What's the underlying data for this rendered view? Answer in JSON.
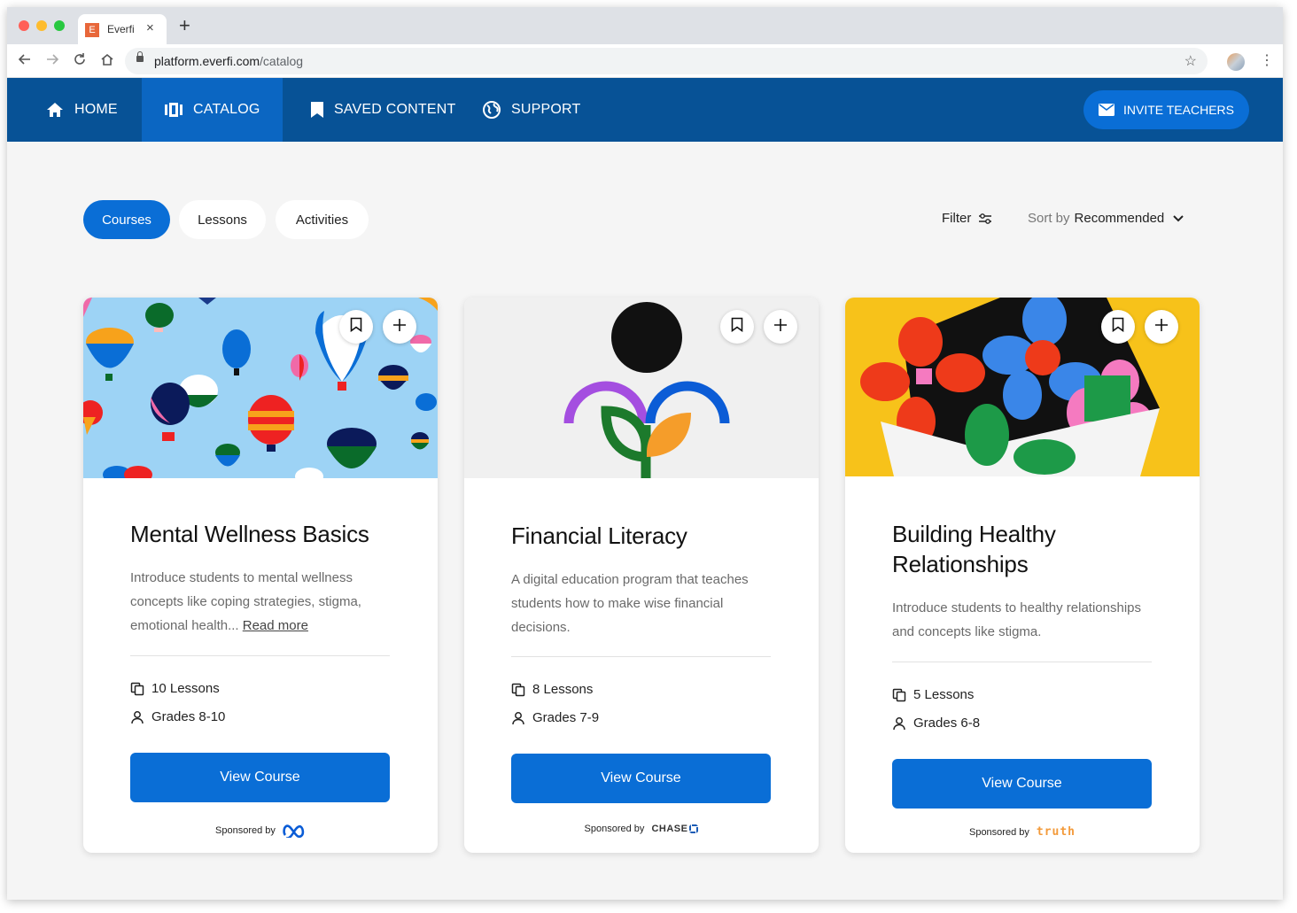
{
  "browser": {
    "tab_title": "Everfi",
    "tab_favicon_letter": "E",
    "url_host": "platform.everfi.com",
    "url_path": "/catalog"
  },
  "nav": {
    "items": [
      {
        "label": "HOME",
        "icon": "home-icon"
      },
      {
        "label": "CATALOG",
        "icon": "catalog-icon",
        "active": true
      },
      {
        "label": "SAVED CONTENT",
        "icon": "bookmark-icon"
      },
      {
        "label": "SUPPORT",
        "icon": "globe-icon"
      }
    ],
    "invite_label": "INVITE TEACHERS",
    "invite_icon": "mail-icon"
  },
  "filters": {
    "tabs": [
      {
        "label": "Courses",
        "active": true
      },
      {
        "label": "Lessons",
        "active": false
      },
      {
        "label": "Activities",
        "active": false
      }
    ],
    "filter_label": "Filter",
    "sort_prefix": "Sort by",
    "sort_value": "Recommended"
  },
  "colors": {
    "nav_bg": "#075296",
    "nav_active": "#0b66c2",
    "primary": "#0a6ed6"
  },
  "cards": [
    {
      "title": "Mental Wellness Basics",
      "description": "Introduce students to mental wellness concepts like coping strategies, stigma, emotional health...",
      "read_more": "Read more",
      "lessons": "10 Lessons",
      "grades": "Grades 8-10",
      "button": "View Course",
      "sponsored_by": "Sponsored by",
      "sponsor_logo": "meta-logo"
    },
    {
      "title": "Financial Literacy",
      "description": "A digital education program that teaches students how to make wise financial decisions.",
      "lessons": "8 Lessons",
      "grades": "Grades 7-9",
      "button": "View Course",
      "sponsored_by": "Sponsored by",
      "sponsor_logo_text": "CHASE"
    },
    {
      "title": "Building Healthy Relationships",
      "description": "Introduce students to healthy relationships and concepts like stigma.",
      "lessons": "5 Lessons",
      "grades": "Grades 6-8",
      "button": "View Course",
      "sponsored_by": "Sponsored by",
      "sponsor_logo_text": "truth"
    }
  ]
}
